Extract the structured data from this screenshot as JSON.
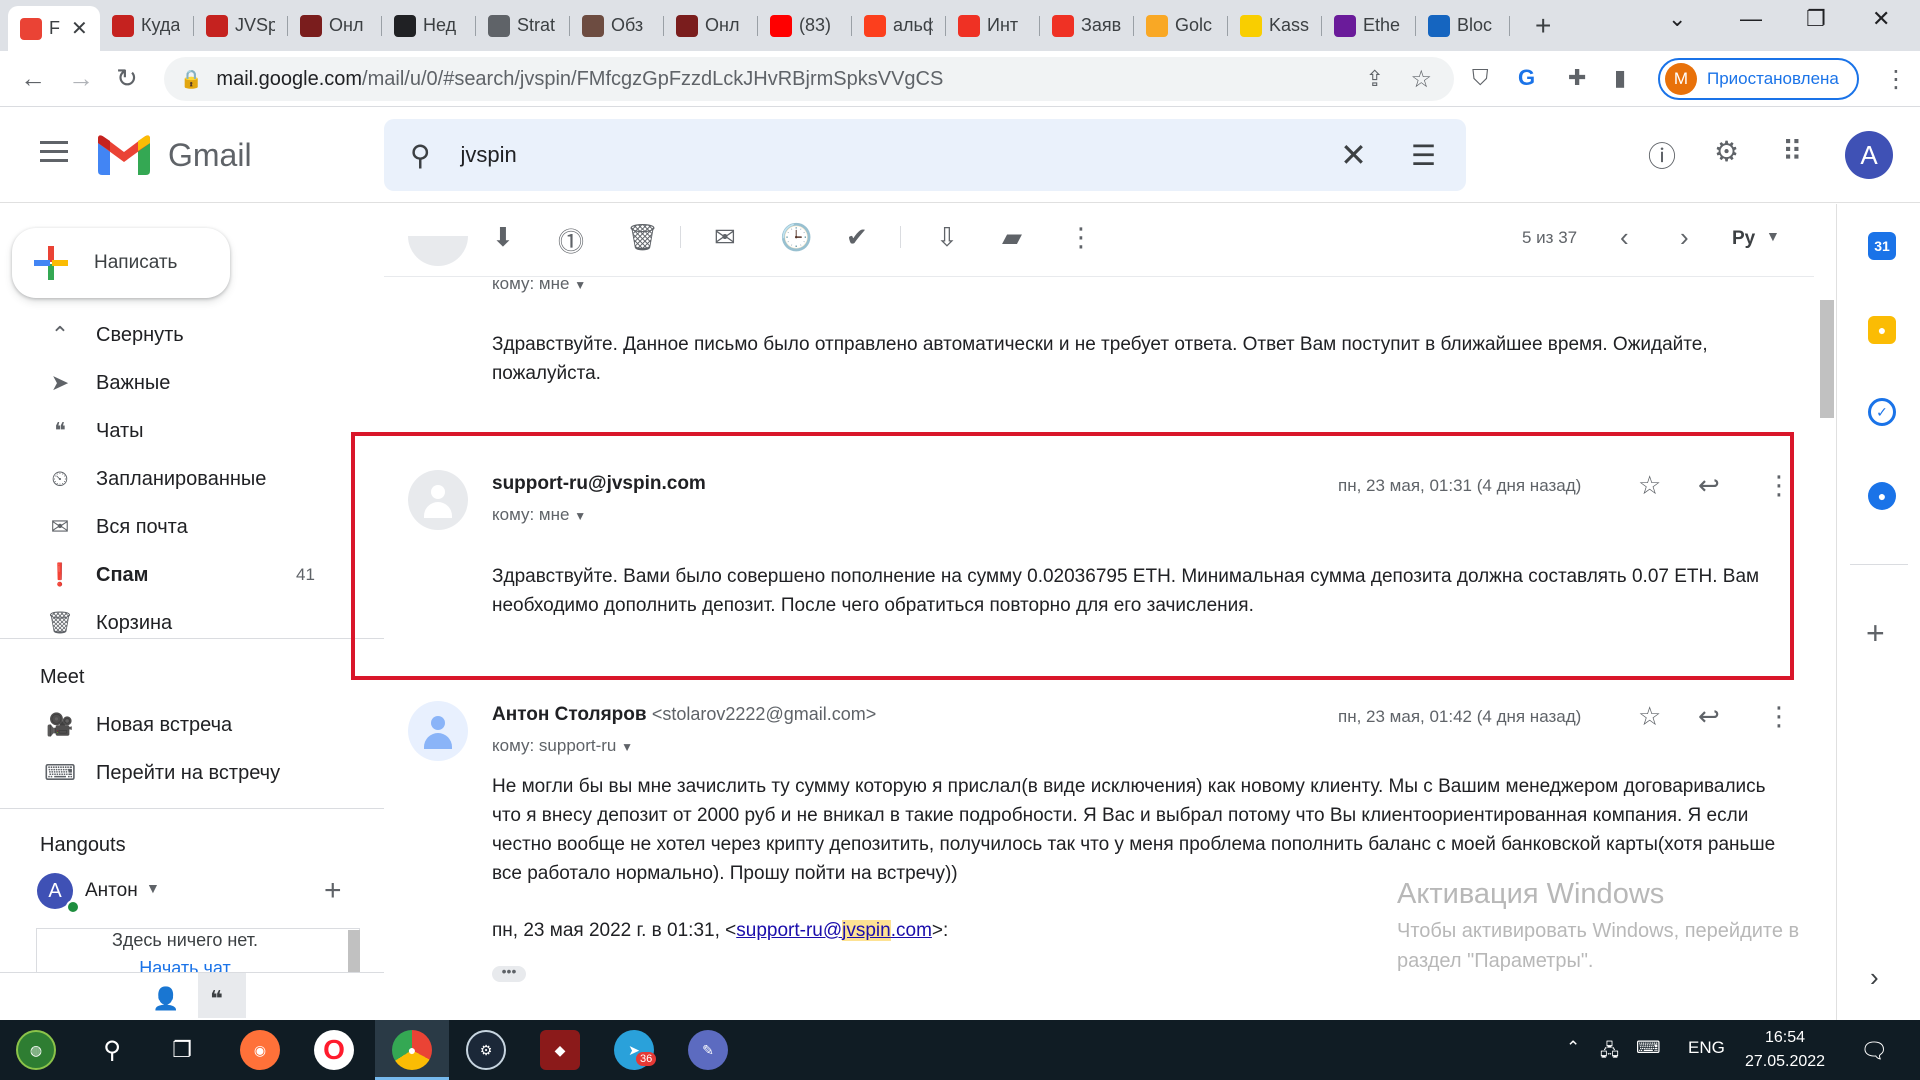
{
  "browser": {
    "tabs": [
      {
        "title": "F",
        "favicon": "gmail-favicon",
        "color": "#ea4335",
        "active": true
      },
      {
        "title": "Куда",
        "favicon": "gift-favicon",
        "color": "#c5221f"
      },
      {
        "title": "JVSp",
        "favicon": "gift-favicon",
        "color": "#c5221f"
      },
      {
        "title": "Онл",
        "favicon": "w-favicon",
        "color": "#7a1d1d"
      },
      {
        "title": "Нед",
        "favicon": "s-favicon",
        "color": "#202124"
      },
      {
        "title": "Strat",
        "favicon": "globe-favicon",
        "color": "#5f6368"
      },
      {
        "title": "Обз",
        "favicon": "bottle-favicon",
        "color": "#6d4c41"
      },
      {
        "title": "Онл",
        "favicon": "w-favicon",
        "color": "#7a1d1d"
      },
      {
        "title": "(83)",
        "favicon": "youtube-favicon",
        "color": "#ff0000"
      },
      {
        "title": "альф",
        "favicon": "yandex-favicon",
        "color": "#fc3f1d"
      },
      {
        "title": "Инт",
        "favicon": "alfa-favicon",
        "color": "#ef3124"
      },
      {
        "title": "Заяв",
        "favicon": "alfa-favicon",
        "color": "#ef3124"
      },
      {
        "title": "Golc",
        "favicon": "g-favicon",
        "color": "#f9a825"
      },
      {
        "title": "Kass",
        "favicon": "k-favicon",
        "color": "#f9ce00"
      },
      {
        "title": "Ethe",
        "favicon": "cube-favicon",
        "color": "#6a1b9a"
      },
      {
        "title": "Bloc",
        "favicon": "block-favicon",
        "color": "#1565c0"
      }
    ],
    "url_main": "mail.google.com",
    "url_rest": "/mail/u/0/#search/jvspin/FMfcgzGpFzzdLckJHvRBjrmSpksVVgCS",
    "profile_initial": "M",
    "profile_label": "Приостановлена"
  },
  "gmail": {
    "logo_text": "Gmail",
    "search_query": "jvspin",
    "account_initial": "A"
  },
  "nav": {
    "compose_label": "Написать",
    "items": [
      {
        "label": "Свернуть",
        "icon": "chevron-up-icon"
      },
      {
        "label": "Важные",
        "icon": "important-label-icon"
      },
      {
        "label": "Чаты",
        "icon": "chat-icon"
      },
      {
        "label": "Запланированные",
        "icon": "scheduled-icon"
      },
      {
        "label": "Вся почта",
        "icon": "all-mail-icon"
      },
      {
        "label": "Спам",
        "icon": "spam-icon",
        "count": "41"
      },
      {
        "label": "Корзина",
        "icon": "trash-icon"
      }
    ],
    "meet_title": "Meet",
    "meet_items": [
      {
        "label": "Новая встреча",
        "icon": "video-icon"
      },
      {
        "label": "Перейти на встречу",
        "icon": "keyboard-icon"
      }
    ],
    "hangouts_title": "Hangouts",
    "hangouts_user": "Антон",
    "hangouts_user_initial": "A",
    "hangouts_empty": "Здесь ничего нет.",
    "hangouts_start": "Начать чат"
  },
  "toolbar": {
    "pager": "5 из 37",
    "language": "Ру"
  },
  "messages": [
    {
      "to": "кому: мне",
      "body": "Здравствуйте. Данное письмо было отправлено автоматически и не требует ответа. Ответ Вам поступит в ближайшее время. Ожидайте, пожалуйста."
    },
    {
      "sender": "support-ru@jvspin.com",
      "to": "кому: мне",
      "date": "пн, 23 мая, 01:31 (4 дня назад)",
      "body": "Здравствуйте. Вами было совершено пополнение на сумму 0.02036795 ETH. Минимальная сумма депозита должна составлять 0.07 ETH. Вам необходимо дополнить депозит. После чего обратиться повторно для его зачисления."
    },
    {
      "sender": "Антон Столяров",
      "sender_email": "<stolarov2222@gmail.com>",
      "to": "кому: support-ru",
      "date": "пн, 23 мая, 01:42 (4 дня назад)",
      "body": "Не могли бы вы мне зачислить ту сумму которую я прислал(в виде исключения) как новому клиенту. Мы с Вашим менеджером договаривались что я внесу депозит от 2000 руб и не вникал в такие подробности. Я Вас и выбрал потому что Вы клиентоориентированная компания. Я если честно вообще не хотел через крипту депозитить, получилось так что у меня проблема пополнить баланс с моей банковской карты(хотя раньше все работало нормально). Прошу пойти на встречу))",
      "quote_prefix": "пн, 23 мая 2022 г. в 01:31, <",
      "quote_link_a": "support-ru@",
      "quote_link_hl": "jvspin",
      "quote_link_b": ".com",
      "quote_suffix": ">:",
      "more": "•••"
    }
  ],
  "watermark": {
    "title": "Активация Windows",
    "text": "Чтобы активировать Windows, перейдите в раздел \"Параметры\"."
  },
  "taskbar": {
    "lang": "ENG",
    "time": "16:54",
    "date": "27.05.2022",
    "telegram_badge": "36"
  },
  "colors": {
    "highlight_border": "#d9162a",
    "accent": "#1a73e8"
  }
}
